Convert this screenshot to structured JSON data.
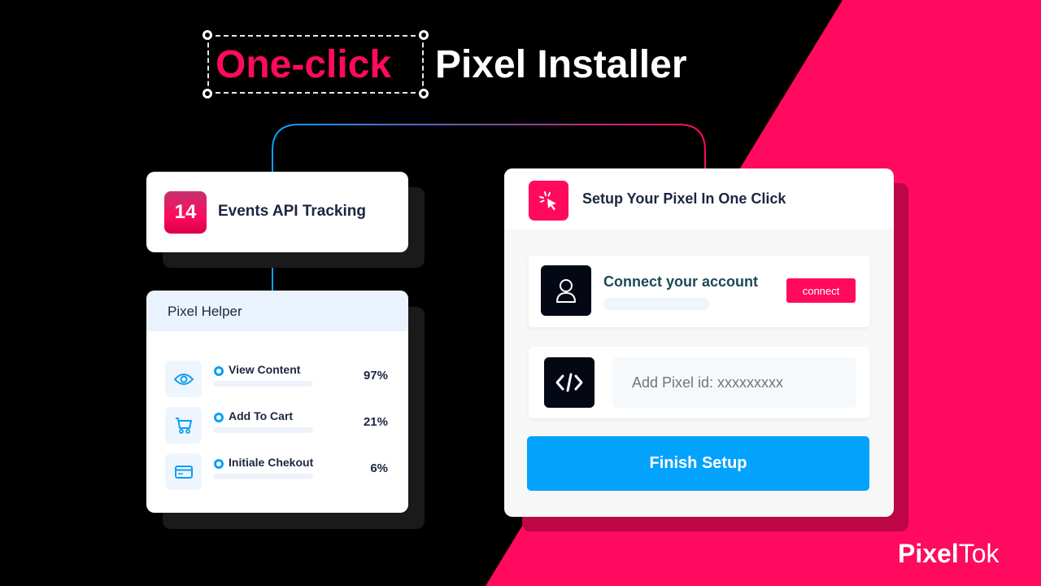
{
  "headline": {
    "highlight": "One-click",
    "rest": "Pixel Installer"
  },
  "colors": {
    "brand_pink": "#ff0a5e",
    "brand_pink_dark": "#bd0646",
    "accent_blue": "#03a2fd",
    "text_dark": "#1c2640",
    "background": "#000000"
  },
  "events_card": {
    "count": "14",
    "label": "Events API Tracking"
  },
  "pixel_helper": {
    "title": "Pixel Helper",
    "rows": [
      {
        "icon": "eye-icon",
        "label": "View Content",
        "percent": "97%"
      },
      {
        "icon": "cart-icon",
        "label": "Add To Cart",
        "percent": "21%"
      },
      {
        "icon": "credit-card-icon",
        "label": "Initiale Chekout",
        "percent": "6%"
      }
    ]
  },
  "setup_card": {
    "icon": "cursor-click-icon",
    "title": "Setup Your Pixel In One Click",
    "connect": {
      "icon": "user-icon",
      "label": "Connect your account",
      "button": "connect"
    },
    "pixel_id": {
      "icon": "code-icon",
      "placeholder": "Add Pixel id: xxxxxxxxx",
      "value": ""
    },
    "finish_button": "Finish Setup"
  },
  "logo": {
    "bold": "Pixel",
    "light": "Tok"
  }
}
